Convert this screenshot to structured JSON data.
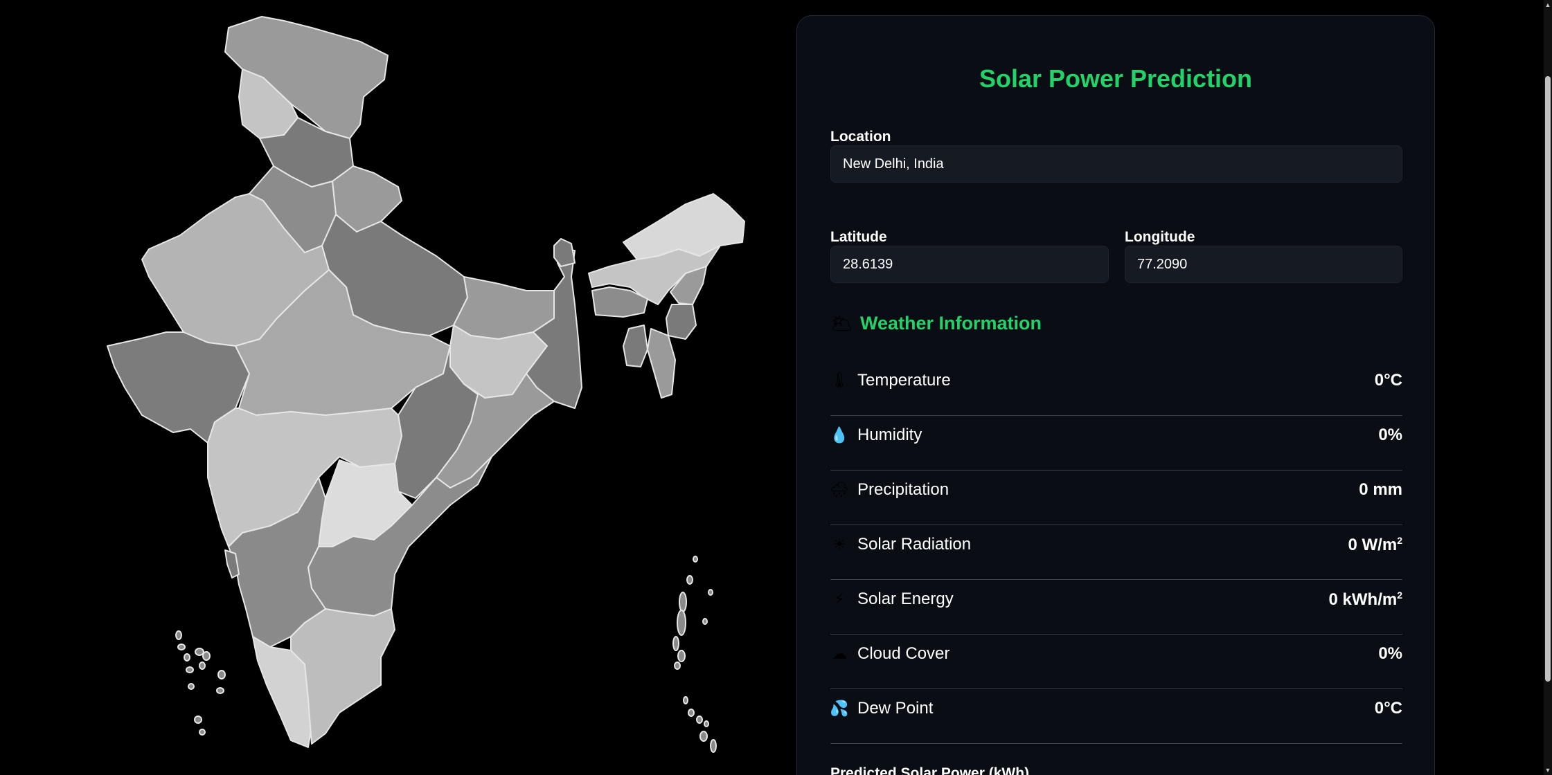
{
  "map": {
    "states": [
      {
        "name": "Jammu & Kashmir / Ladakh",
        "fill": "#9a9a9a"
      },
      {
        "name": "Himachal Pradesh",
        "fill": "#c4c4c4"
      },
      {
        "name": "Punjab",
        "fill": "#7a7a7a"
      },
      {
        "name": "Uttarakhand",
        "fill": "#9a9a9a"
      },
      {
        "name": "Haryana",
        "fill": "#8c8c8c"
      },
      {
        "name": "Rajasthan",
        "fill": "#b4b4b4"
      },
      {
        "name": "Uttar Pradesh",
        "fill": "#7a7a7a"
      },
      {
        "name": "Gujarat",
        "fill": "#7c7c7c"
      },
      {
        "name": "Madhya Pradesh",
        "fill": "#a8a8a8"
      },
      {
        "name": "Bihar",
        "fill": "#9a9a9a"
      },
      {
        "name": "Jharkhand",
        "fill": "#c4c4c4"
      },
      {
        "name": "West Bengal",
        "fill": "#7a7a7a"
      },
      {
        "name": "Sikkim",
        "fill": "#7a7a7a"
      },
      {
        "name": "Arunachal Pradesh",
        "fill": "#d8d8d8"
      },
      {
        "name": "Assam",
        "fill": "#c4c4c4"
      },
      {
        "name": "Meghalaya",
        "fill": "#8c8c8c"
      },
      {
        "name": "Nagaland",
        "fill": "#9a9a9a"
      },
      {
        "name": "Manipur",
        "fill": "#7a7a7a"
      },
      {
        "name": "Mizoram",
        "fill": "#9a9a9a"
      },
      {
        "name": "Tripura",
        "fill": "#7a7a7a"
      },
      {
        "name": "Chhattisgarh",
        "fill": "#7a7a7a"
      },
      {
        "name": "Odisha",
        "fill": "#9a9a9a"
      },
      {
        "name": "Maharashtra",
        "fill": "#c4c4c4"
      },
      {
        "name": "Telangana",
        "fill": "#dcdcdc"
      },
      {
        "name": "Andhra Pradesh",
        "fill": "#8c8c8c"
      },
      {
        "name": "Karnataka",
        "fill": "#8a8a8a"
      },
      {
        "name": "Goa",
        "fill": "#7a7a7a"
      },
      {
        "name": "Kerala",
        "fill": "#d2d2d2"
      },
      {
        "name": "Tamil Nadu",
        "fill": "#bdbdbd"
      }
    ]
  },
  "panel": {
    "title": "Solar Power Prediction",
    "location": {
      "label": "Location",
      "value": "New Delhi, India"
    },
    "latitude": {
      "label": "Latitude",
      "value": "28.6139"
    },
    "longitude": {
      "label": "Longitude",
      "value": "77.2090"
    },
    "weather": {
      "heading": "Weather Information",
      "heading_icon": "sun-behind-cloud-icon",
      "rows": [
        {
          "icon": "thermometer-icon",
          "glyph": "🌡",
          "label": "Temperature",
          "value": "0°C",
          "sup": ""
        },
        {
          "icon": "droplet-icon",
          "glyph": "💧",
          "label": "Humidity",
          "value": "0%",
          "sup": ""
        },
        {
          "icon": "rain-cloud-icon",
          "glyph": "🌧",
          "label": "Precipitation",
          "value": "0 mm",
          "sup": ""
        },
        {
          "icon": "sun-icon",
          "glyph": "☀",
          "label": "Solar Radiation",
          "value": "0 W/m",
          "sup": "2"
        },
        {
          "icon": "lightning-icon",
          "glyph": "⚡",
          "label": "Solar Energy",
          "value": "0 kWh/m",
          "sup": "2"
        },
        {
          "icon": "cloud-icon",
          "glyph": "☁",
          "label": "Cloud Cover",
          "value": "0%",
          "sup": ""
        },
        {
          "icon": "sweat-droplets-icon",
          "glyph": "💦",
          "label": "Dew Point",
          "value": "0°C",
          "sup": ""
        }
      ]
    },
    "prediction_label": "Predicted Solar Power (kWh)"
  },
  "colors": {
    "accent": "#22d36a",
    "panel_bg": "#0a0d14",
    "input_bg": "#161a23",
    "page_bg": "#000000"
  }
}
